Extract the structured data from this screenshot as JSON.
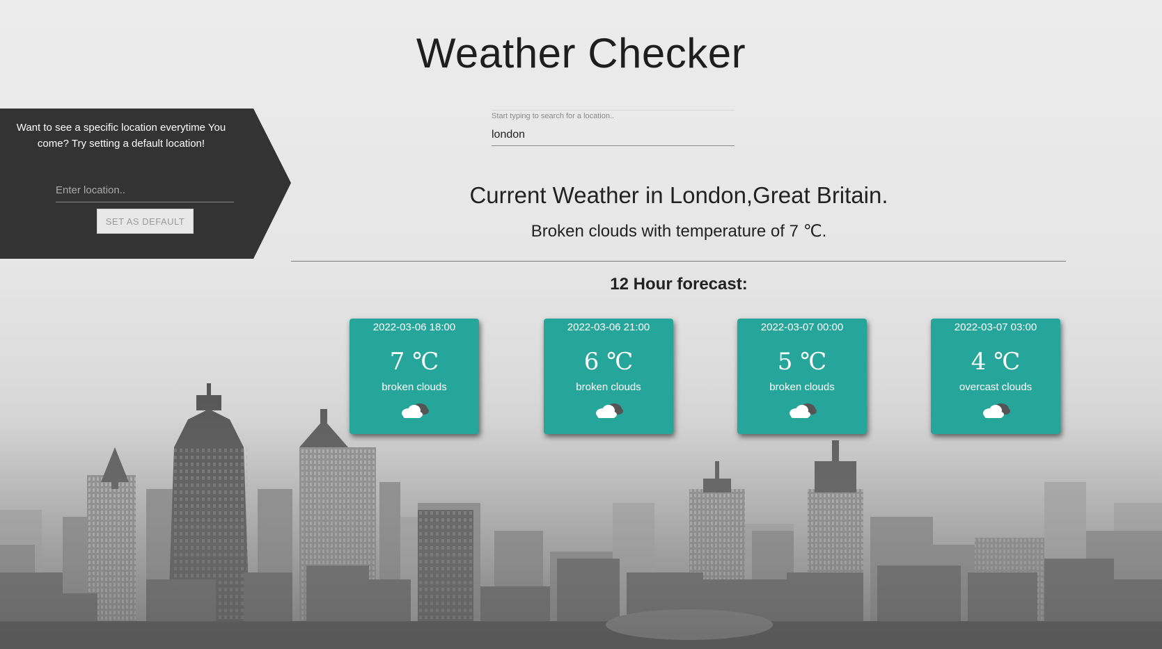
{
  "app": {
    "title": "Weather Checker"
  },
  "default_location": {
    "message": "Want to see a specific location everytime You come? Try setting a default location!",
    "input_placeholder": "Enter location..",
    "input_value": "",
    "button_label": "SET AS DEFAULT"
  },
  "search": {
    "label": "Start typing to search for a location..",
    "value": "london"
  },
  "current": {
    "heading": "Current Weather in London,Great Britain.",
    "description": "Broken clouds with temperature of 7 ℃."
  },
  "forecast": {
    "heading": "12 Hour forecast:",
    "cards": [
      {
        "time": "2022-03-06 18:00",
        "temp": "7 ℃",
        "condition": "broken clouds",
        "icon": "broken-clouds-icon"
      },
      {
        "time": "2022-03-06 21:00",
        "temp": "6 ℃",
        "condition": "broken clouds",
        "icon": "broken-clouds-icon"
      },
      {
        "time": "2022-03-07 00:00",
        "temp": "5 ℃",
        "condition": "broken clouds",
        "icon": "broken-clouds-icon"
      },
      {
        "time": "2022-03-07 03:00",
        "temp": "4 ℃",
        "condition": "overcast clouds",
        "icon": "overcast-clouds-icon"
      }
    ]
  },
  "colors": {
    "card": "#26a69a",
    "panel": "#333333"
  }
}
